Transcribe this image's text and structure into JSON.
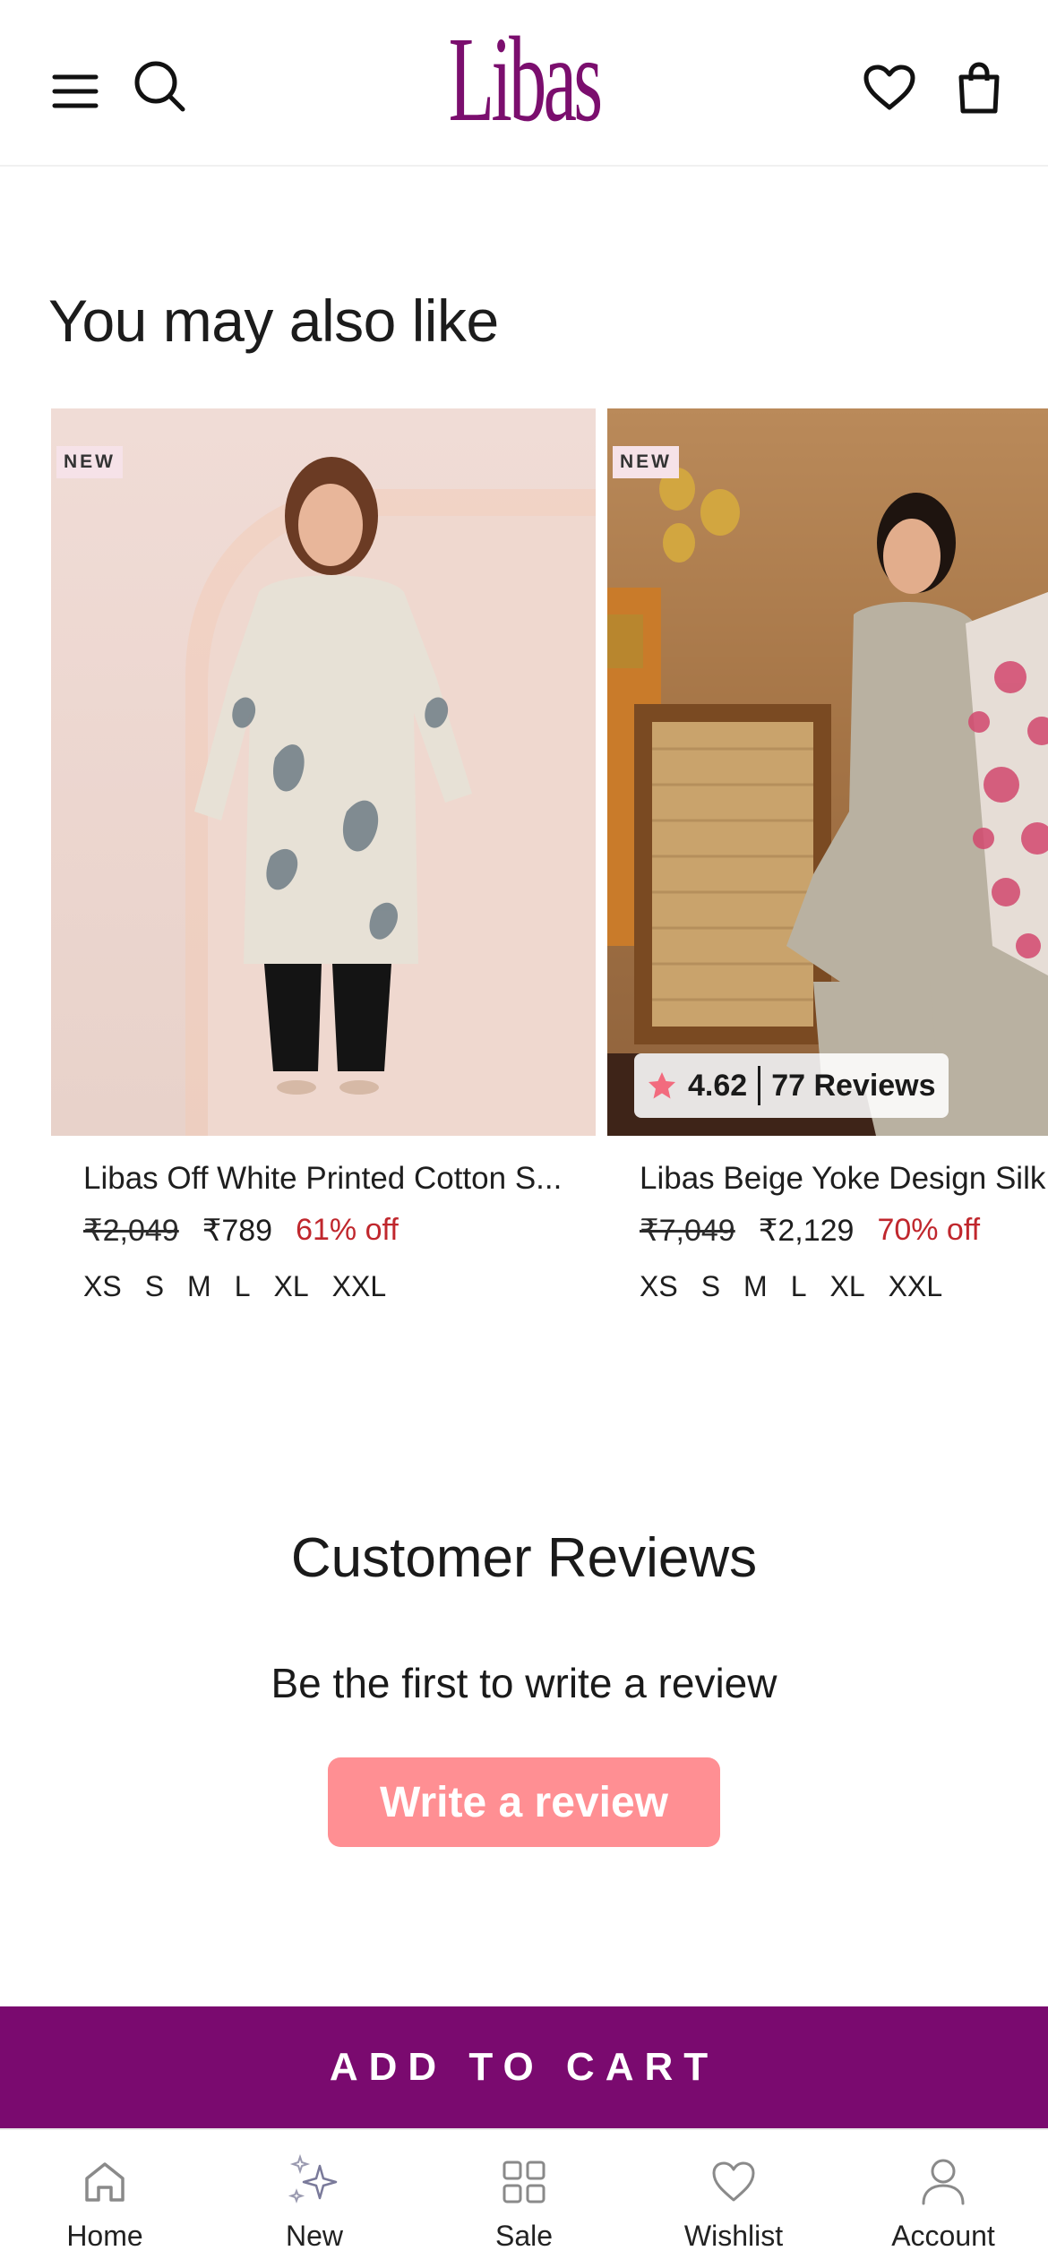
{
  "header": {
    "logo_text": "Libas",
    "icons": [
      "menu-icon",
      "search-icon",
      "heart-icon",
      "shopping-bag-icon"
    ]
  },
  "recommendations": {
    "title": "You may also like",
    "products": [
      {
        "badge": "NEW",
        "name": "Libas Off White Printed Cotton S...",
        "price_original": "₹2,049",
        "price_sale": "₹789",
        "discount": "61% off",
        "sizes": [
          "XS",
          "S",
          "M",
          "L",
          "XL",
          "XXL"
        ]
      },
      {
        "badge": "NEW",
        "name": "Libas Beige Yoke Design Silk",
        "price_original": "₹7,049",
        "price_sale": "₹2,129",
        "discount": "70% off",
        "sizes": [
          "XS",
          "S",
          "M",
          "L",
          "XL",
          "XXL"
        ],
        "rating": "4.62",
        "reviews": "77 Reviews"
      }
    ]
  },
  "reviews": {
    "title": "Customer Reviews",
    "subtitle": "Be the first to write a review",
    "button_label": "Write a review"
  },
  "cart": {
    "button_label": "ADD TO CART"
  },
  "bottom_nav": {
    "items": [
      {
        "label": "Home",
        "icon": "home-icon"
      },
      {
        "label": "New",
        "icon": "sparkle-icon"
      },
      {
        "label": "Sale",
        "icon": "grid-icon"
      },
      {
        "label": "Wishlist",
        "icon": "heart-icon"
      },
      {
        "label": "Account",
        "icon": "user-icon"
      }
    ]
  },
  "colors": {
    "brand": "#7a0a6f",
    "review_button": "#ff8f93",
    "discount": "#c0272d"
  }
}
